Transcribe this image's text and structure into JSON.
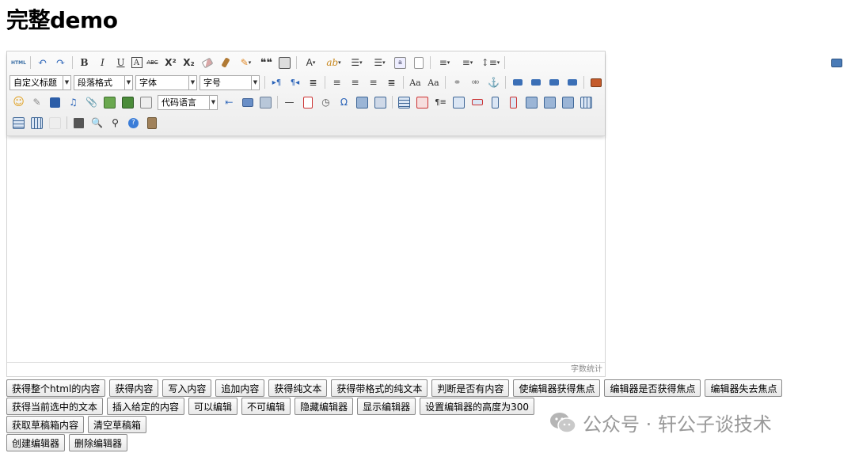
{
  "page": {
    "title": "完整demo"
  },
  "editor": {
    "toolbar": {
      "row1_text": {
        "bold": "B",
        "italic": "I",
        "underline": "U",
        "fontborder": "A",
        "strike": "ABC",
        "sup": "X²",
        "sub": "X₂",
        "blockquote": "❝❝",
        "forecolor": "A",
        "html": "HTML"
      },
      "selects": {
        "customstyle": "自定义标题",
        "paragraph": "段落格式",
        "fontfamily": "字体",
        "fontsize": "字号",
        "insertcode": "代码语言"
      }
    },
    "wordcount_label": "字数统计"
  },
  "buttons": {
    "row1": [
      "获得整个html的内容",
      "获得内容",
      "写入内容",
      "追加内容",
      "获得纯文本",
      "获得带格式的纯文本",
      "判断是否有内容",
      "使编辑器获得焦点",
      "编辑器是否获得焦点",
      "编辑器失去焦点"
    ],
    "row2": [
      "获得当前选中的文本",
      "插入给定的内容",
      "可以编辑",
      "不可编辑",
      "隐藏编辑器",
      "显示编辑器",
      "设置编辑器的高度为300"
    ],
    "row3": [
      "获取草稿箱内容",
      "清空草稿箱"
    ],
    "row4": [
      "创建编辑器",
      "删除编辑器"
    ]
  },
  "watermark": {
    "text": "公众号 · 轩公子谈技术",
    "icon": "wechat-icon"
  }
}
